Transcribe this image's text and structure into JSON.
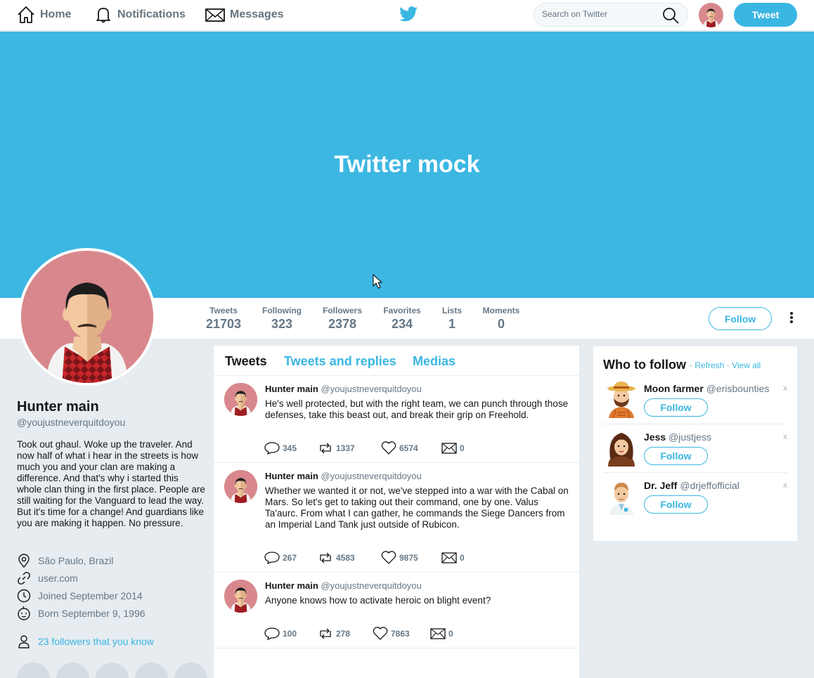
{
  "nav": {
    "home": "Home",
    "notifications": "Notifications",
    "messages": "Messages",
    "search_placeholder": "Search on Twitter",
    "tweet_button": "Tweet"
  },
  "banner": {
    "title": "Twitter mock"
  },
  "stats": [
    {
      "label": "Tweets",
      "value": "21703"
    },
    {
      "label": "Following",
      "value": "323"
    },
    {
      "label": "Followers",
      "value": "2378"
    },
    {
      "label": "Favorites",
      "value": "234"
    },
    {
      "label": "Lists",
      "value": "1"
    },
    {
      "label": "Moments",
      "value": "0"
    }
  ],
  "follow_button": "Follow",
  "profile": {
    "name": "Hunter main",
    "handle": "@youjustneverquitdoyou",
    "bio": "Took out ghaul. Woke up the traveler. And now half of what i hear in the streets is how much you and your clan are making a difference. And that's why i started this whole clan thing in the first place. People are still waiting for the Vanguard to lead the way. But it's time for a change! And guardians like you are making it happen. No pressure.",
    "location": "São Paulo, Brazil",
    "website": "user.com",
    "joined": "Joined September 2014",
    "born": "Born September 9, 1996",
    "followers_you_know": "23 followers that you know"
  },
  "tabs": [
    "Tweets",
    "Tweets and replies",
    "Medias"
  ],
  "tweets": [
    {
      "name": "Hunter main",
      "handle": "@youjustneverquitdoyou",
      "text": "He's well protected, but with the right team, we can punch through those defenses, take this beast out, and break their grip on Freehold.",
      "replies": "345",
      "retweets": "1337",
      "likes": "6574",
      "messages": "0"
    },
    {
      "name": "Hunter main",
      "handle": "@youjustneverquitdoyou",
      "text": "Whether we wanted it or not, we've stepped into a war with the Cabal on Mars. So let's get to taking out their command, one by one. Valus Ta'aurc. From what I can gather, he commands the Siege Dancers from an Imperial Land Tank just outside of Rubicon.",
      "replies": "267",
      "retweets": "4583",
      "likes": "9875",
      "messages": "0"
    },
    {
      "name": "Hunter main",
      "handle": "@youjustneverquitdoyou",
      "text": "Anyone knows how to activate heroic on blight event?",
      "replies": "100",
      "retweets": "278",
      "likes": "7863",
      "messages": "0"
    }
  ],
  "who_to_follow": {
    "title": "Who to follow",
    "refresh": "Refresh",
    "separator": "·",
    "view_all": "View all",
    "dismiss": "x",
    "users": [
      {
        "name": "Moon farmer",
        "handle": "@erisbounties",
        "button": "Follow"
      },
      {
        "name": "Jess",
        "handle": "@justjess",
        "button": "Follow"
      },
      {
        "name": "Dr. Jeff",
        "handle": "@drjeffofficial",
        "button": "Follow"
      }
    ]
  },
  "colors": {
    "accent": "#3ab6e2",
    "banner": "#3cb7e2",
    "background": "#e6ecf0"
  }
}
